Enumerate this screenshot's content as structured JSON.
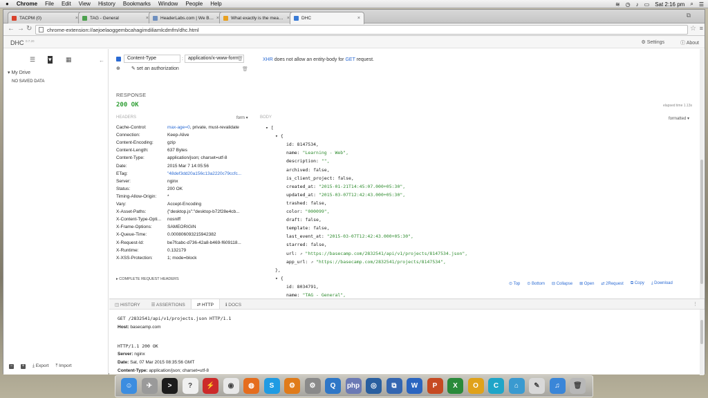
{
  "menubar": {
    "apple": "",
    "app": "Chrome",
    "items": [
      "File",
      "Edit",
      "View",
      "History",
      "Bookmarks",
      "Window",
      "People",
      "Help"
    ],
    "clock": "Sat 2:16 pm"
  },
  "tabs": [
    {
      "label": "TACPM (0)",
      "color": "#d9412b",
      "active": false
    },
    {
      "label": "TAG - General",
      "color": "#4da14f",
      "active": false
    },
    {
      "label": "HeaderLabs.com | We Bu...",
      "color": "#6e8fbf",
      "active": false
    },
    {
      "label": "What exactly is the meanin...",
      "color": "#e8a020",
      "active": false
    },
    {
      "label": "DHC",
      "color": "#3a7bd5",
      "active": true
    }
  ],
  "address": {
    "url": "chrome-extension://aejoelaoggembcahagimdiliamlcdmfm/dhc.html"
  },
  "app": {
    "name": "DHC",
    "version": "0.7.20",
    "settings": "Settings",
    "about": "About"
  },
  "sidebar": {
    "my_drive": "My Drive",
    "no_saved": "NO SAVED DATA",
    "export": "Export",
    "import": "Import"
  },
  "request": {
    "header_name": "Content-Type",
    "header_value": "application/x-www-form",
    "set_auth": "set an authorization",
    "note_xhr": "XHR",
    "note_mid": " does not allow an entity-body for ",
    "note_get": "GET",
    "note_end": " request."
  },
  "response": {
    "label": "RESPONSE",
    "status": "200 OK",
    "elapsed": "elapsed time 1.13s",
    "headers_label": "HEADERS",
    "form": "form",
    "body_label": "BODY",
    "formatted": "formatted",
    "complete": "COMPLETE REQUEST HEADERS",
    "headers": [
      {
        "k": "Cache-Control:",
        "v": "max-age=0, private, must-revalidate",
        "blue": "max-age=0"
      },
      {
        "k": "Connection:",
        "v": "Keep-Alive"
      },
      {
        "k": "Content-Encoding:",
        "v": "gzip"
      },
      {
        "k": "Content-Length:",
        "v": "637 Bytes"
      },
      {
        "k": "Content-Type:",
        "v": "application/json; charset=utf-8"
      },
      {
        "k": "Date:",
        "v": "2015 Mar 7 14:05:56"
      },
      {
        "k": "ETag:",
        "v": "\"48def3dd20a156c13a2220c79ccfc...",
        "blue": "all"
      },
      {
        "k": "Server:",
        "v": "nginx"
      },
      {
        "k": "Status:",
        "v": "200 OK"
      },
      {
        "k": "Timing-Allow-Origin:",
        "v": "*"
      },
      {
        "k": "Vary:",
        "v": "Accept-Encoding"
      },
      {
        "k": "X-Asset-Paths:",
        "v": "{\"desktop.js\":\"desktop-b72f28e4cb..."
      },
      {
        "k": "X-Content-Type-Opti...",
        "v": "nosniff"
      },
      {
        "k": "X-Frame-Options:",
        "v": "SAMEORIGIN"
      },
      {
        "k": "X-Queue-Time:",
        "v": "0.000806093215942382"
      },
      {
        "k": "X-Request-Id:",
        "v": "be7fcabc-d736-42a8-b469-f609118..."
      },
      {
        "k": "X-Runtime:",
        "v": "0.132179"
      },
      {
        "k": "X-XSS-Protection:",
        "v": "1; mode=block"
      }
    ],
    "json": [
      {
        "t": "arr",
        "text": "["
      },
      {
        "t": "obj",
        "text": "{"
      },
      {
        "t": "kv",
        "k": "id",
        "v": "8147534",
        "s": false
      },
      {
        "t": "kv",
        "k": "name",
        "v": "\"Learning - Web\"",
        "s": true
      },
      {
        "t": "kv",
        "k": "description",
        "v": "\"\"",
        "s": true
      },
      {
        "t": "kv",
        "k": "archived",
        "v": "false",
        "s": false
      },
      {
        "t": "kv",
        "k": "is_client_project",
        "v": "false",
        "s": false
      },
      {
        "t": "kv",
        "k": "created_at",
        "v": "\"2015-01-21T14:45:07.000+05:30\"",
        "s": true
      },
      {
        "t": "kv",
        "k": "updated_at",
        "v": "\"2015-03-07T12:42:43.000+05:30\"",
        "s": true
      },
      {
        "t": "kv",
        "k": "trashed",
        "v": "false",
        "s": false
      },
      {
        "t": "kv",
        "k": "color",
        "v": "\"000099\"",
        "s": true
      },
      {
        "t": "kv",
        "k": "draft",
        "v": "false",
        "s": false
      },
      {
        "t": "kv",
        "k": "template",
        "v": "false",
        "s": false
      },
      {
        "t": "kv",
        "k": "last_event_at",
        "v": "\"2015-03-07T12:42:43.000+05:30\"",
        "s": true
      },
      {
        "t": "kv",
        "k": "starred",
        "v": "false",
        "s": false
      },
      {
        "t": "link",
        "k": "url",
        "v": "\"https://basecamp.com/2832541/api/v1/projects/8147534.json\""
      },
      {
        "t": "link",
        "k": "app_url",
        "v": "\"https://basecamp.com/2832541/projects/8147534\""
      },
      {
        "t": "close",
        "text": "},"
      },
      {
        "t": "obj",
        "text": "{"
      },
      {
        "t": "kv",
        "k": "id",
        "v": "8034791",
        "s": false
      },
      {
        "t": "kv",
        "k": "name",
        "v": "\"TAG - General\"",
        "s": true
      }
    ],
    "actions": [
      "Top",
      "Bottom",
      "Collapse",
      "Open",
      "2Request",
      "Copy",
      "Download"
    ]
  },
  "bottom": {
    "tabs": [
      "HISTORY",
      "ASSERTIONS",
      "HTTP",
      "DOCS"
    ],
    "active": "HTTP",
    "request_line": "GET /2832541/api/v1/projects.json HTTP/1.1",
    "host_k": "Host:",
    "host_v": "basecamp.com",
    "status_line": "HTTP/1.1 200 OK",
    "resp": [
      {
        "k": "Server:",
        "v": "nginx"
      },
      {
        "k": "Date:",
        "v": "Sat, 07 Mar 2015 08:35:56 GMT"
      },
      {
        "k": "Content-Type:",
        "v": "application/json; charset=utf-8"
      }
    ]
  },
  "dock": [
    {
      "name": "finder",
      "color": "#3c8de0",
      "g": "☺"
    },
    {
      "name": "launchpad",
      "color": "#9a9a9a",
      "g": "✈"
    },
    {
      "name": "terminal",
      "color": "#1c1c1c",
      "g": ">"
    },
    {
      "name": "spotlight",
      "color": "#f0f0f0",
      "g": "?"
    },
    {
      "name": "app-red",
      "color": "#cc2a2a",
      "g": "⚡"
    },
    {
      "name": "chrome",
      "color": "#e8e8e8",
      "g": "◉"
    },
    {
      "name": "firefox",
      "color": "#e56d1e",
      "g": "◍"
    },
    {
      "name": "skype",
      "color": "#1f9be3",
      "g": "S"
    },
    {
      "name": "settings",
      "color": "#e07b1a",
      "g": "⚙"
    },
    {
      "name": "sys-prefs",
      "color": "#8a8a8a",
      "g": "⚙"
    },
    {
      "name": "quicktime",
      "color": "#2f77c7",
      "g": "Q"
    },
    {
      "name": "php",
      "color": "#6b7ab5",
      "g": "php"
    },
    {
      "name": "browser",
      "color": "#2a5fa0",
      "g": "◎"
    },
    {
      "name": "app-blue",
      "color": "#3466b1",
      "g": "⧉"
    },
    {
      "name": "word",
      "color": "#2b65c0",
      "g": "W"
    },
    {
      "name": "powerpoint",
      "color": "#c64a22",
      "g": "P"
    },
    {
      "name": "excel",
      "color": "#2a8a3a",
      "g": "X"
    },
    {
      "name": "outlook",
      "color": "#e0a21a",
      "g": "O"
    },
    {
      "name": "app-cyan",
      "color": "#1fa5c8",
      "g": "C"
    },
    {
      "name": "app-teal",
      "color": "#3a9ad0",
      "g": "⌂"
    },
    {
      "name": "preview",
      "color": "#d8d8d8",
      "g": "✎"
    },
    {
      "name": "itunes",
      "color": "#3a86d8",
      "g": "♫"
    },
    {
      "name": "trash",
      "color": "#b8b8b8",
      "g": "🗑"
    }
  ]
}
